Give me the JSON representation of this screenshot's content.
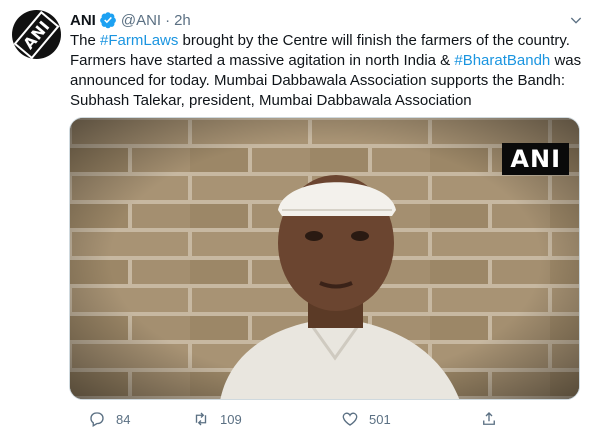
{
  "tweet": {
    "author": {
      "name": "ANI",
      "handle": "@ANI",
      "separator": "·",
      "time": "2h",
      "avatar_logo": "ANI"
    },
    "body": {
      "p1": "The ",
      "tag1": "#FarmLaws",
      "p2": " brought by the Centre will finish the farmers of the country. Farmers have started a massive agitation in north India & ",
      "tag2": "#BharatBandh",
      "p3": " was announced for today. Mumbai Dabbawala Association supports the Bandh: Subhash Talekar, president, Mumbai Dabbawala Association"
    },
    "media": {
      "watermark": "ANI"
    },
    "actions": {
      "reply_icon": "comment-icon",
      "reply_count": "84",
      "retweet_icon": "retweet-icon",
      "retweet_count": "109",
      "like_icon": "heart-icon",
      "like_count": "501",
      "share_icon": "share-icon"
    },
    "colors": {
      "link": "#1b95e0",
      "verified": "#1da1f2",
      "muted": "#5b7083"
    }
  }
}
